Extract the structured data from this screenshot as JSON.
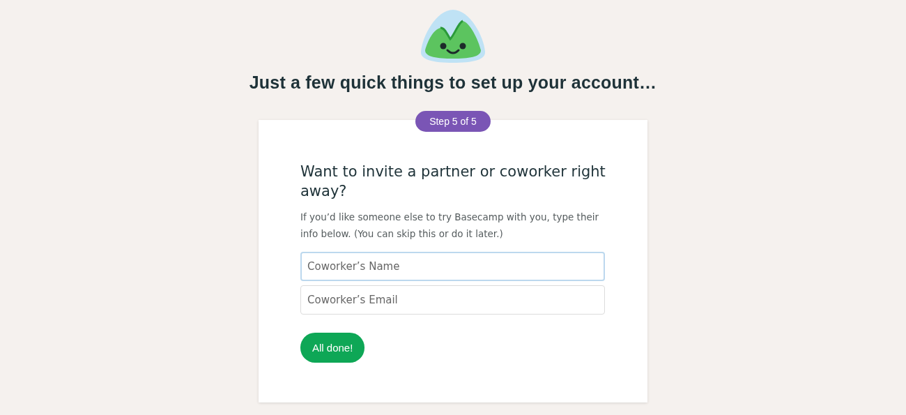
{
  "heading": "Just a few quick things to set up your account…",
  "step_badge": "Step 5 of 5",
  "card": {
    "title": "Want to invite a partner or coworker right away?",
    "description": "If you’d like someone else to try Basecamp with you, type their info below. (You can skip this or do it later.)",
    "fields": [
      {
        "placeholder": "Coworker’s Name",
        "focused": true
      },
      {
        "placeholder": "Coworker’s Email",
        "focused": false
      }
    ],
    "button": "All done!"
  }
}
